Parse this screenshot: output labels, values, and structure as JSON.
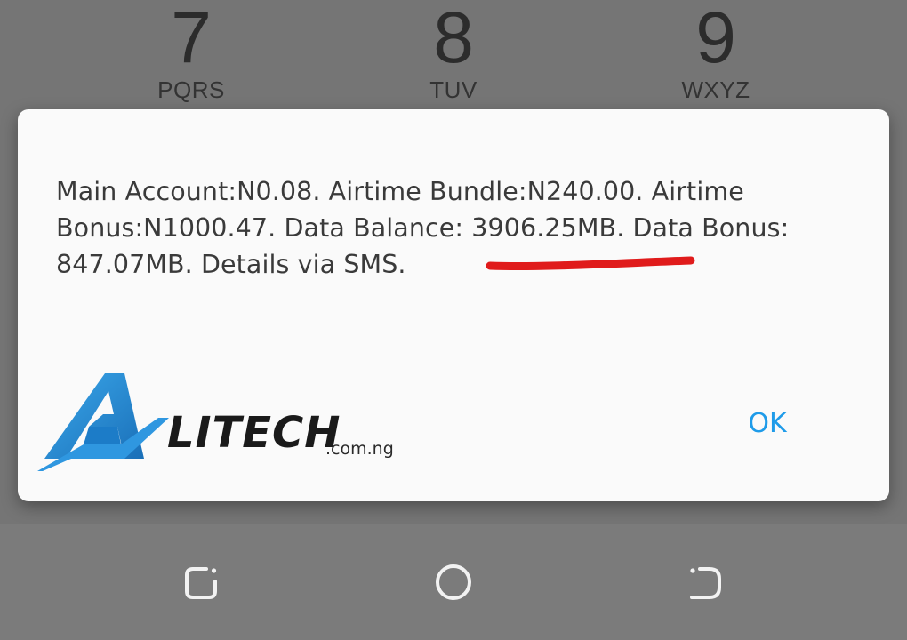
{
  "dialer": {
    "keys": [
      {
        "digit": "7",
        "letters": "PQRS"
      },
      {
        "digit": "8",
        "letters": "TUV"
      },
      {
        "digit": "9",
        "letters": "WXYZ"
      }
    ]
  },
  "dialog": {
    "message": "Main Account:N0.08. Airtime Bundle:N240.00. Airtime Bonus:N1000.47. Data Balance: 3906.25MB. Data Bonus: 847.07MB. Details via SMS.",
    "ok_label": "OK"
  },
  "watermark": {
    "brand": "LITECH",
    "domain": ".com.ng"
  },
  "colors": {
    "accent": "#1e9be9",
    "underline": "#e01b1b",
    "logo_blue": "#2a8fd6"
  },
  "navbar": {
    "icons": [
      "recent-apps-icon",
      "home-icon",
      "back-icon"
    ]
  }
}
